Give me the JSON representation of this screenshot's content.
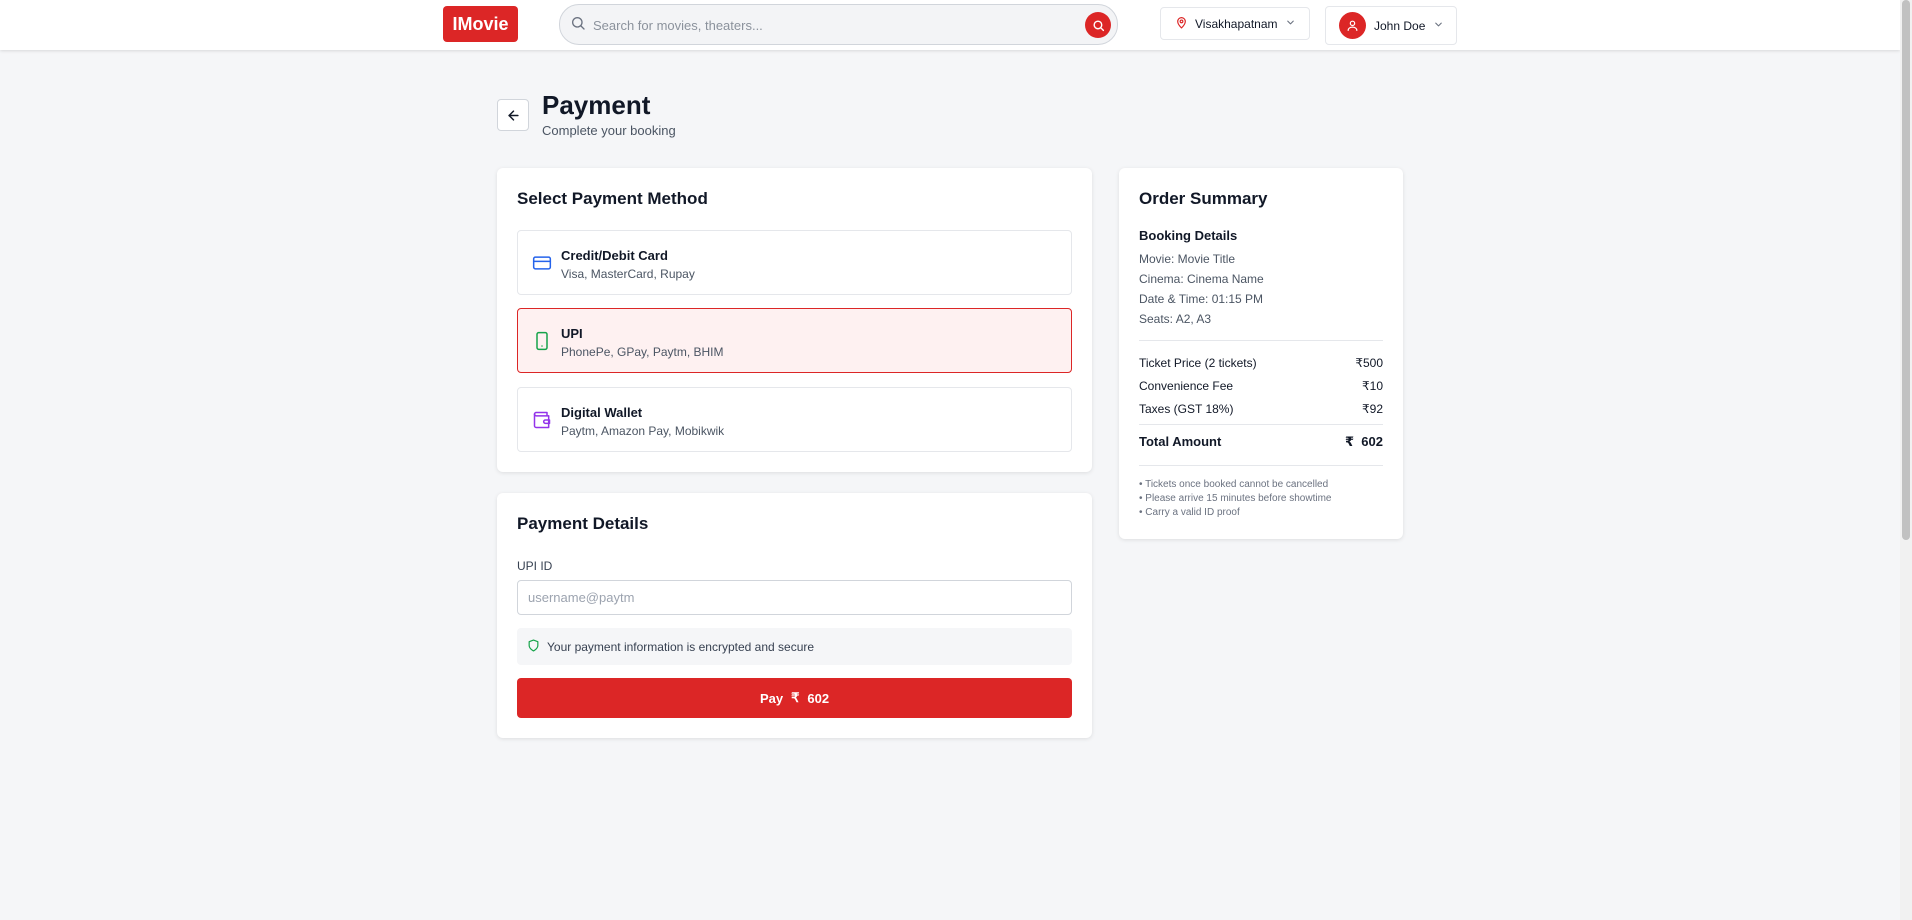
{
  "header": {
    "logo": "IMovie",
    "search_placeholder": "Search for movies, theaters...",
    "location": "Visakhapatnam",
    "user_name": "John Doe"
  },
  "page": {
    "title": "Payment",
    "subtitle": "Complete your booking"
  },
  "payment_methods": {
    "title": "Select Payment Method",
    "items": [
      {
        "name": "Credit/Debit Card",
        "desc": "Visa, MasterCard, Rupay",
        "icon": "credit-card-icon",
        "selected": false
      },
      {
        "name": "UPI",
        "desc": "PhonePe, GPay, Paytm, BHIM",
        "icon": "smartphone-icon",
        "selected": true
      },
      {
        "name": "Digital Wallet",
        "desc": "Paytm, Amazon Pay, Mobikwik",
        "icon": "wallet-icon",
        "selected": false
      }
    ]
  },
  "payment_details": {
    "title": "Payment Details",
    "field_label": "UPI ID",
    "field_placeholder": "username@paytm",
    "field_value": "",
    "secure_text": "Your payment information is encrypted and secure",
    "pay_label": "Pay",
    "pay_currency": "₹",
    "pay_amount": "602"
  },
  "order_summary": {
    "title": "Order Summary",
    "booking_title": "Booking Details",
    "details": [
      "Movie: Movie Title",
      "Cinema: Cinema Name",
      "Date & Time: 01:15 PM",
      "Seats: A2, A3"
    ],
    "lines": [
      {
        "label": "Ticket Price (2 tickets)",
        "value": "₹500"
      },
      {
        "label": "Convenience Fee",
        "value": "₹10"
      },
      {
        "label": "Taxes (GST 18%)",
        "value": "₹92"
      }
    ],
    "total_label": "Total Amount",
    "total_value": "₹  602",
    "notes": [
      "• Tickets once booked cannot be cancelled",
      "• Please arrive 15 minutes before showtime",
      "• Carry a valid ID proof"
    ]
  },
  "colors": {
    "brand": "#dc2626",
    "selected_bg": "#fef1f1",
    "card_icon": "#2563eb",
    "upi_icon": "#16a34a",
    "wallet_icon": "#9333ea",
    "shield_icon": "#16a34a"
  }
}
